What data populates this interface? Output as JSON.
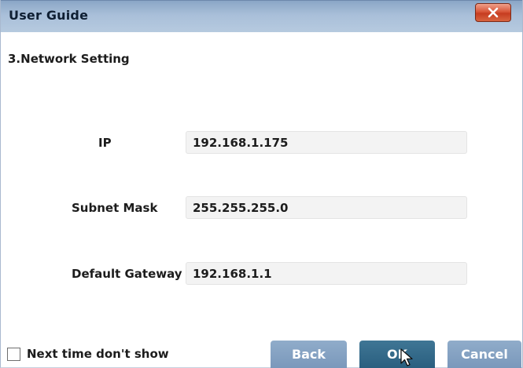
{
  "window": {
    "title": "User Guide",
    "close_icon": "close-x-icon"
  },
  "section": {
    "title": "3.Network Setting"
  },
  "fields": {
    "ip": {
      "label": "IP",
      "value": "192.168.1.175"
    },
    "subnet": {
      "label": "Subnet Mask",
      "value": "255.255.255.0"
    },
    "gateway": {
      "label": "Default Gateway",
      "value": "192.168.1.1"
    }
  },
  "footer": {
    "checkbox_label": "Next time don't show",
    "checkbox_checked": false,
    "back_label": "Back",
    "ok_label": "OK",
    "cancel_label": "Cancel"
  },
  "colors": {
    "titlebar": "#a9bfd9",
    "close_button": "#d9573a",
    "button_inactive": "#849fc1",
    "button_active": "#316a8a",
    "field_background": "#f3f3f3"
  }
}
